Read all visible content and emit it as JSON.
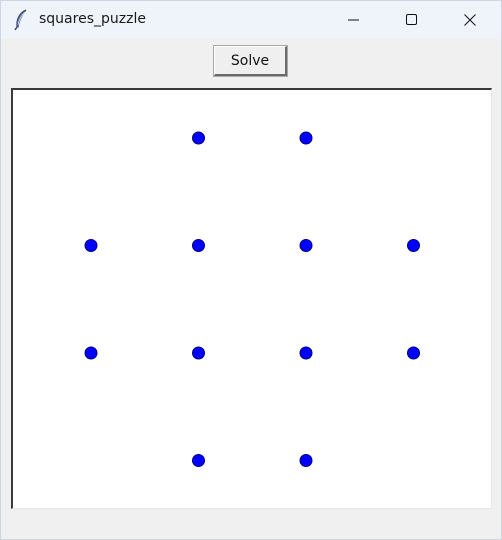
{
  "window": {
    "title": "squares_puzzle",
    "app_icon": "feather-icon",
    "controls": [
      "minimize-icon",
      "maximize-icon",
      "close-icon"
    ]
  },
  "toolbar": {
    "solve_label": "Solve"
  },
  "canvas": {
    "background": "#ffffff",
    "dot_color": "#0000ff",
    "dot_outline": "#000080",
    "grid_points": [
      {
        "row": 0,
        "col": 1
      },
      {
        "row": 0,
        "col": 2
      },
      {
        "row": 1,
        "col": 0
      },
      {
        "row": 1,
        "col": 1
      },
      {
        "row": 1,
        "col": 2
      },
      {
        "row": 1,
        "col": 3
      },
      {
        "row": 2,
        "col": 0
      },
      {
        "row": 2,
        "col": 1
      },
      {
        "row": 2,
        "col": 2
      },
      {
        "row": 2,
        "col": 3
      },
      {
        "row": 3,
        "col": 1
      },
      {
        "row": 3,
        "col": 2
      }
    ]
  }
}
